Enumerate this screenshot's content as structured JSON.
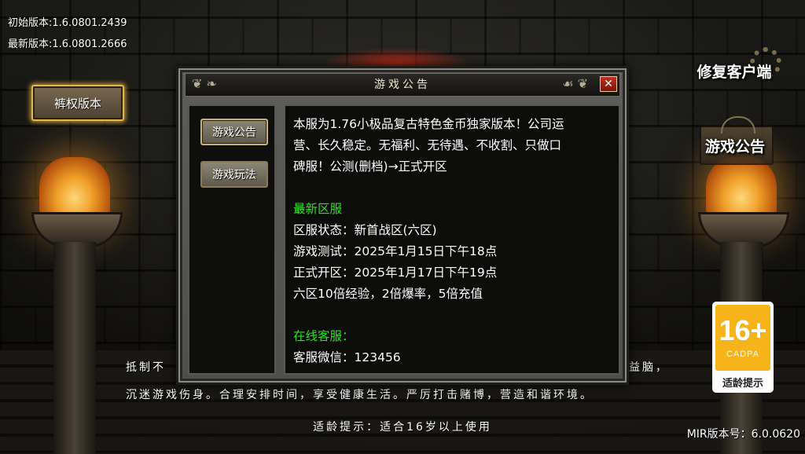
{
  "app": {
    "initial_version": "初始版本:1.6.0801.2439",
    "latest_version": "最新版本:1.6.0801.2666",
    "mir_version": "MIR版本号：6.0.0620"
  },
  "side_buttons": {
    "copyright": "裤权版本",
    "repair_client": "修复客户端",
    "notice": "游戏公告"
  },
  "age_badge": {
    "number": "16+",
    "org": "CADPA",
    "tip": "适龄提示"
  },
  "advice": {
    "line1_start": "抵制不",
    "line1_end": "益脑，",
    "line2": "沉迷游戏伤身。合理安排时间，享受健康生活。严厉打击赌博，营造和谐环境。"
  },
  "age_hint": "适龄提示：适合16岁以上使用",
  "dialog": {
    "title": "游戏公告",
    "close": "✕",
    "tabs": [
      {
        "label": "游戏公告",
        "active": true
      },
      {
        "label": "游戏玩法",
        "active": false
      }
    ],
    "content": [
      {
        "text": "本服为1.76小极品复古特色金币独家版本！公司运",
        "color": "white"
      },
      {
        "text": "营、长久稳定。无福利、无待遇、不收割、只做口",
        "color": "white"
      },
      {
        "text": "碑服！公测(删档)→正式开区",
        "color": "white"
      },
      {
        "text": "",
        "color": "white"
      },
      {
        "text": "最新区服",
        "color": "green"
      },
      {
        "text": "区服状态：新首战区(六区)",
        "color": "white"
      },
      {
        "text": "游戏测试：2025年1月15日下午18点",
        "color": "white"
      },
      {
        "text": "正式开区：2025年1月17日下午19点",
        "color": "white"
      },
      {
        "text": "六区10倍经验，2倍爆率，5倍充值",
        "color": "white"
      },
      {
        "text": "",
        "color": "white"
      },
      {
        "text": "在线客服：",
        "color": "green"
      },
      {
        "text": "客服微信：123456",
        "color": "white"
      }
    ]
  },
  "colors": {
    "highlight_green": "#28e21e",
    "button_gold": "#e2b74a",
    "close_red": "#c0301e",
    "badge_orange": "#f6b31a"
  }
}
